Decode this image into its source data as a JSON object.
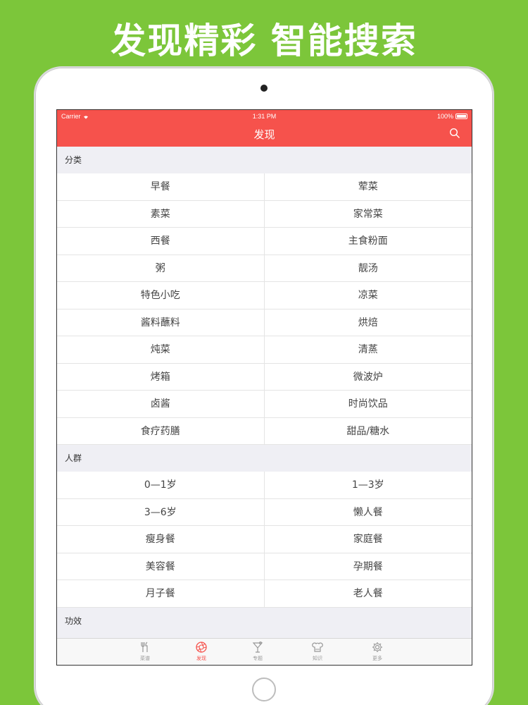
{
  "headline": "发现精彩 智能搜索",
  "status": {
    "carrier": "Carrier",
    "time": "1:31 PM",
    "battery": "100%"
  },
  "nav": {
    "title": "发现",
    "search_icon": "search-icon"
  },
  "sections": [
    {
      "title": "分类",
      "items": [
        "早餐",
        "荤菜",
        "素菜",
        "家常菜",
        "西餐",
        "主食粉面",
        "粥",
        "靓汤",
        "特色小吃",
        "凉菜",
        "酱料蘸料",
        "烘焙",
        "炖菜",
        "清蒸",
        "烤箱",
        "微波炉",
        "卤酱",
        "时尚饮品",
        "食疗药膳",
        "甜品/糖水"
      ]
    },
    {
      "title": "人群",
      "items": [
        "0—1岁",
        "1—3岁",
        "3—6岁",
        "懒人餐",
        "瘦身餐",
        "家庭餐",
        "美容餐",
        "孕期餐",
        "月子餐",
        "老人餐"
      ]
    },
    {
      "title": "功效",
      "items": []
    }
  ],
  "tabs": [
    {
      "label": "菜谱",
      "icon": "fork-knife-icon",
      "active": false
    },
    {
      "label": "发现",
      "icon": "aperture-icon",
      "active": true
    },
    {
      "label": "专题",
      "icon": "cocktail-icon",
      "active": false
    },
    {
      "label": "知识",
      "icon": "chef-icon",
      "active": false
    },
    {
      "label": "更多",
      "icon": "gear-icon",
      "active": false
    }
  ],
  "colors": {
    "background": "#7cc63a",
    "accent": "#f6524c",
    "tab_inactive": "#999999"
  }
}
